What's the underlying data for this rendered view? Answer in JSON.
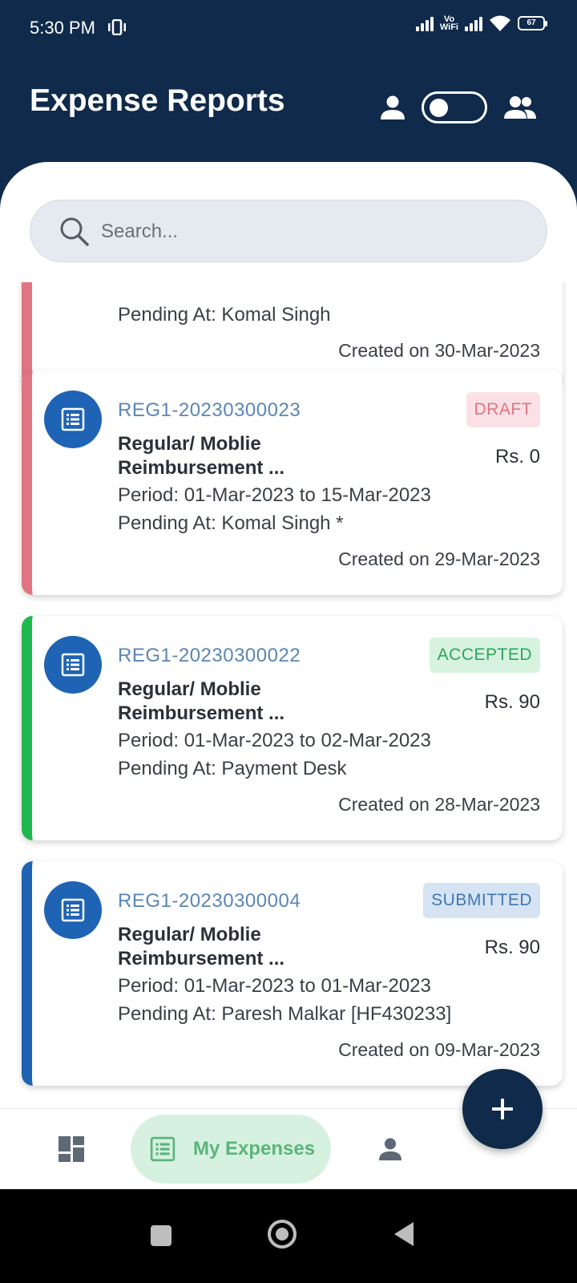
{
  "status_bar": {
    "time": "5:30 PM",
    "vowifi_top": "Vo",
    "vowifi_bottom": "WiFi",
    "battery": "67"
  },
  "header": {
    "title": "Expense Reports",
    "icons": [
      "person-icon",
      "toggle-switch",
      "group-icon"
    ]
  },
  "search": {
    "placeholder": "Search..."
  },
  "cards": [
    {
      "pending": "Pending At: Komal Singh",
      "created": "Created on 30-Mar-2023",
      "accent": "#e07482"
    },
    {
      "id": "REG1-20230300023",
      "status": "DRAFT",
      "status_color": "#e07482",
      "status_bg": "#fbe1e5",
      "type_line1": "Regular/ Moblie",
      "type_line2": "Reimbursement ...",
      "amount": "Rs. 0",
      "period": "Period: 01-Mar-2023 to 15-Mar-2023",
      "pending": "Pending At: Komal Singh *",
      "created": "Created on 29-Mar-2023",
      "accent": "#e07482"
    },
    {
      "id": "REG1-20230300022",
      "status": "ACCEPTED",
      "status_color": "#2aa65b",
      "status_bg": "#d7f3e0",
      "type_line1": "Regular/ Moblie",
      "type_line2": "Reimbursement ...",
      "amount": "Rs. 90",
      "period": "Period: 01-Mar-2023 to 02-Mar-2023",
      "pending": "Pending At: Payment Desk",
      "created": "Created on 28-Mar-2023",
      "accent": "#1fb84e"
    },
    {
      "id": "REG1-20230300004",
      "status": "SUBMITTED",
      "status_color": "#3f78b5",
      "status_bg": "#d6e3f2",
      "type_line1": "Regular/ Moblie",
      "type_line2": "Reimbursement ...",
      "amount": "Rs. 90",
      "period": "Period: 01-Mar-2023 to 01-Mar-2023",
      "pending": "Pending At: Paresh  Malkar [HF430233]",
      "created": "Created on 09-Mar-2023",
      "accent": "#1f63b5"
    }
  ],
  "fab": {
    "icon": "plus-icon"
  },
  "bottom_nav": {
    "items": [
      {
        "icon": "dashboard-icon"
      },
      {
        "icon": "list-icon",
        "label": "My Expenses"
      },
      {
        "icon": "person-icon"
      }
    ]
  },
  "colors": {
    "header_bg": "#0f2a4a",
    "card_icon_bg": "#1f63b5",
    "id_text": "#5a86b5",
    "active_nav_bg": "#d6f1df",
    "active_nav_text": "#5bb47d"
  }
}
